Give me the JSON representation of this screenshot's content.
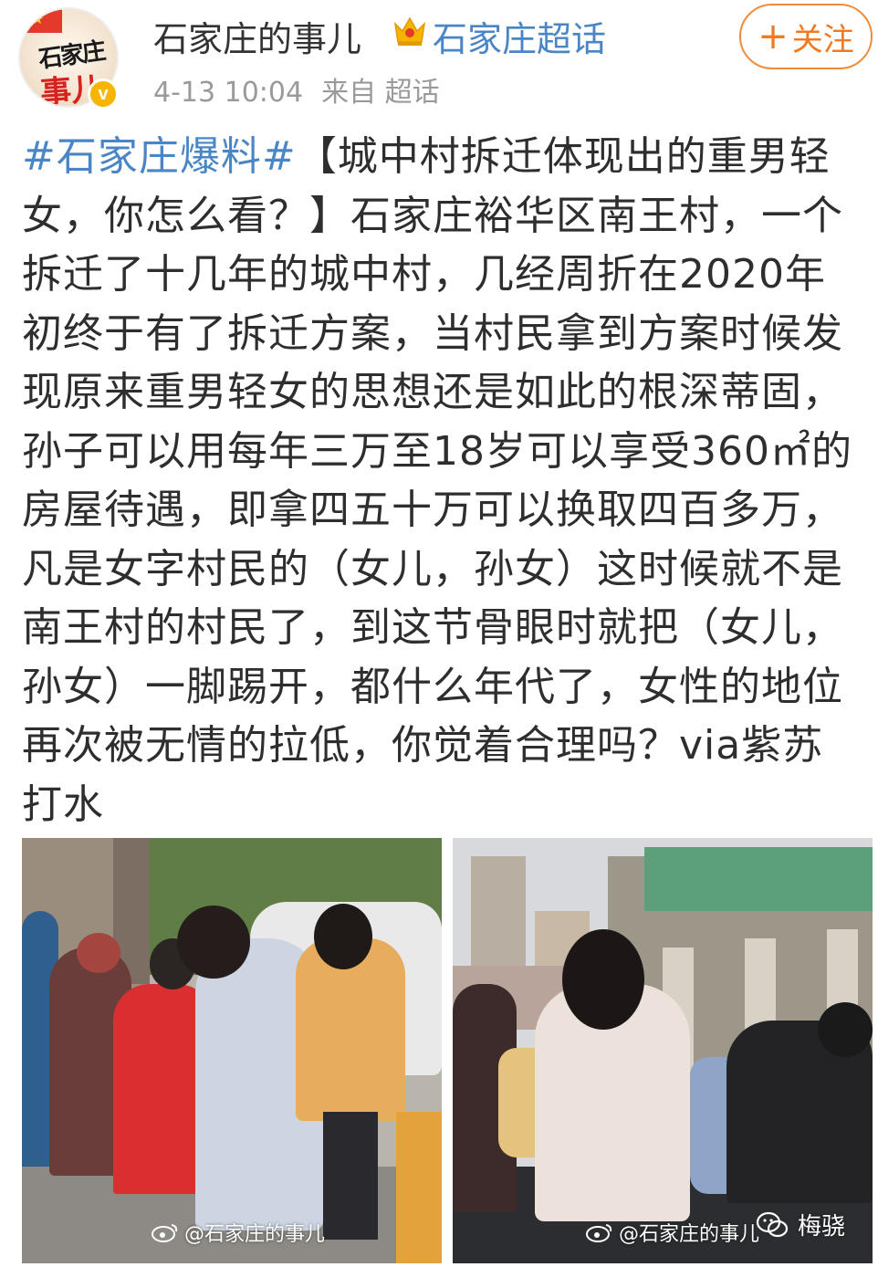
{
  "author": {
    "avatar_text_top": "石家庄",
    "avatar_text_bottom": "事儿",
    "verify_mark": "v",
    "name": "石家庄的事儿",
    "supertopic": "石家庄超话",
    "time": "4-13 10:04",
    "source": "来自 超话"
  },
  "follow_button": {
    "plus": "+",
    "label": "关注"
  },
  "post": {
    "hashtag": "#石家庄爆料#",
    "text": "【城中村拆迁体现出的重男轻女，你怎么看？】石家庄裕华区南王村，一个拆迁了十几年的城中村，几经周折在2020年初终于有了拆迁方案，当村民拿到方案时候发现原来重男轻女的思想还是如此的根深蒂固，孙子可以用每年三万至18岁可以享受360㎡的房屋待遇，即拿四五十万可以换取四百多万，凡是女字村民的（女儿，孙女）这时候就不是南王村的村民了，到这节骨眼时就把（女儿，孙女）一脚踢开，都什么年代了，女性的地位再次被无情的拉低，你觉着合理吗？via紫苏打水"
  },
  "photos": [
    {
      "watermark": "@石家庄的事儿"
    },
    {
      "watermark": "@石家庄的事儿"
    }
  ],
  "wechat_mark": "梅骁",
  "colors": {
    "link": "#4a86c6",
    "follow": "#ef7a22",
    "meta": "#9a9a9a"
  },
  "icons": [
    "crown-icon",
    "weibo-icon",
    "wechat-icon",
    "verified-icon"
  ]
}
